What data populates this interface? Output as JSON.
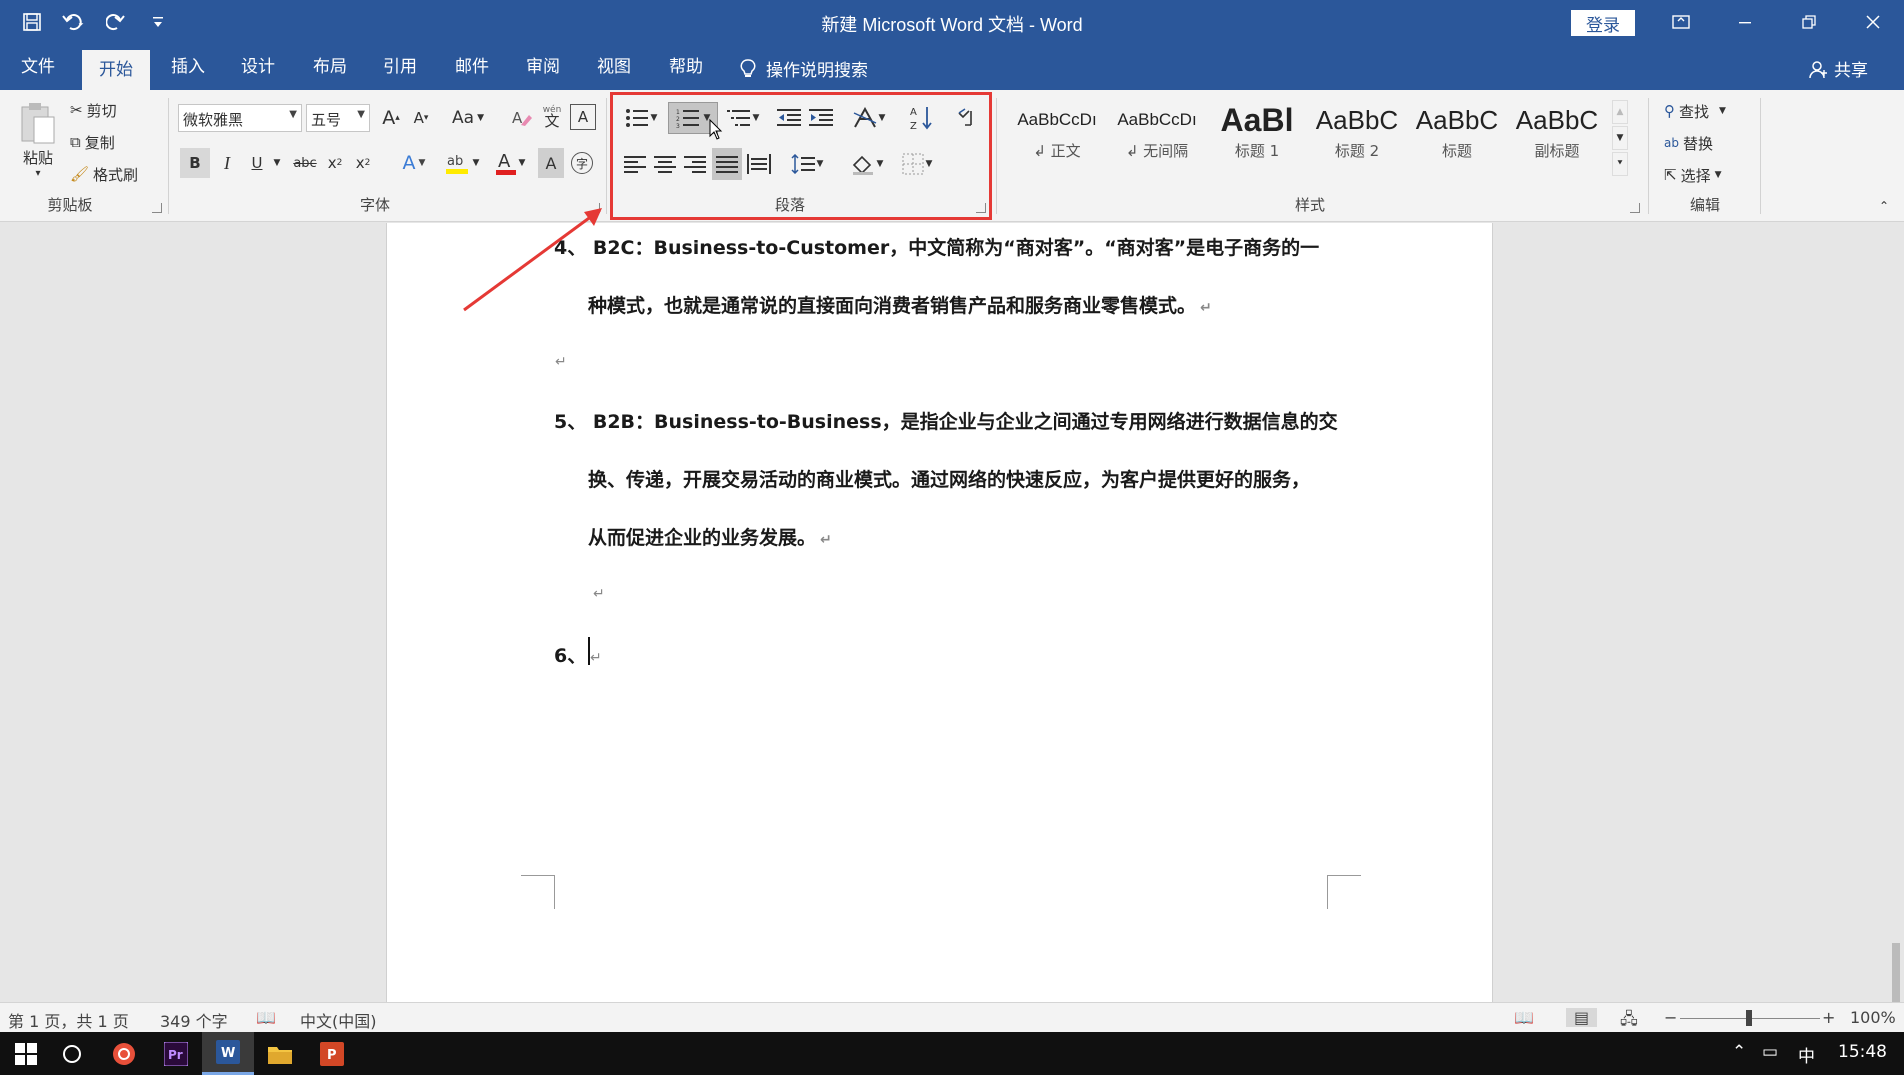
{
  "window": {
    "title": "新建 Microsoft Word 文档  -  Word",
    "login_label": "登录"
  },
  "tabs": [
    {
      "label": "文件"
    },
    {
      "label": "开始"
    },
    {
      "label": "插入"
    },
    {
      "label": "设计"
    },
    {
      "label": "布局"
    },
    {
      "label": "引用"
    },
    {
      "label": "邮件"
    },
    {
      "label": "审阅"
    },
    {
      "label": "视图"
    },
    {
      "label": "帮助"
    }
  ],
  "tell_me": "操作说明搜索",
  "share_label": "共享",
  "clipboard": {
    "paste": "粘贴",
    "cut": "剪切",
    "copy": "复制",
    "format_painter": "格式刷",
    "group": "剪贴板"
  },
  "font": {
    "name": "微软雅黑",
    "size": "五号",
    "change_case": "Aa",
    "group": "字体"
  },
  "paragraph": {
    "group": "段落"
  },
  "styles": {
    "group": "样式",
    "items": [
      {
        "sample": "AaBbCcDı",
        "name": "↲ 正文"
      },
      {
        "sample": "AaBbCcDı",
        "name": "↲ 无间隔"
      },
      {
        "sample": "AaBl",
        "name": "标题 1"
      },
      {
        "sample": "AaBbC",
        "name": "标题 2"
      },
      {
        "sample": "AaBbC",
        "name": "标题"
      },
      {
        "sample": "AaBbC",
        "name": "副标题"
      }
    ]
  },
  "editing": {
    "find": "查找",
    "replace": "替换",
    "select": "选择",
    "group": "编辑"
  },
  "document": {
    "item4_line1": "4、 B2C：Business-to-Customer，中文简称为“商对客”。“商对客”是电子商务的一",
    "item4_line2": "种模式，也就是通常说的直接面向消费者销售产品和服务商业零售模式。",
    "item5_line1": "5、 B2B：Business-to-Business，是指企业与企业之间通过专用网络进行数据信息的交",
    "item5_line2": "换、传递，开展交易活动的商业模式。通过网络的快速反应，为客户提供更好的服务，",
    "item5_line3": "从而促进企业的业务发展。",
    "item6": "6、",
    "para_mark": "↵"
  },
  "status": {
    "page": "第 1 页，共 1 页",
    "words": "349 个字",
    "language": "中文(中国)",
    "zoom": "100%"
  },
  "taskbar": {
    "ime": "中",
    "time": "15:48"
  },
  "colors": {
    "accent": "#2b579a",
    "highlight": "#e53935"
  }
}
